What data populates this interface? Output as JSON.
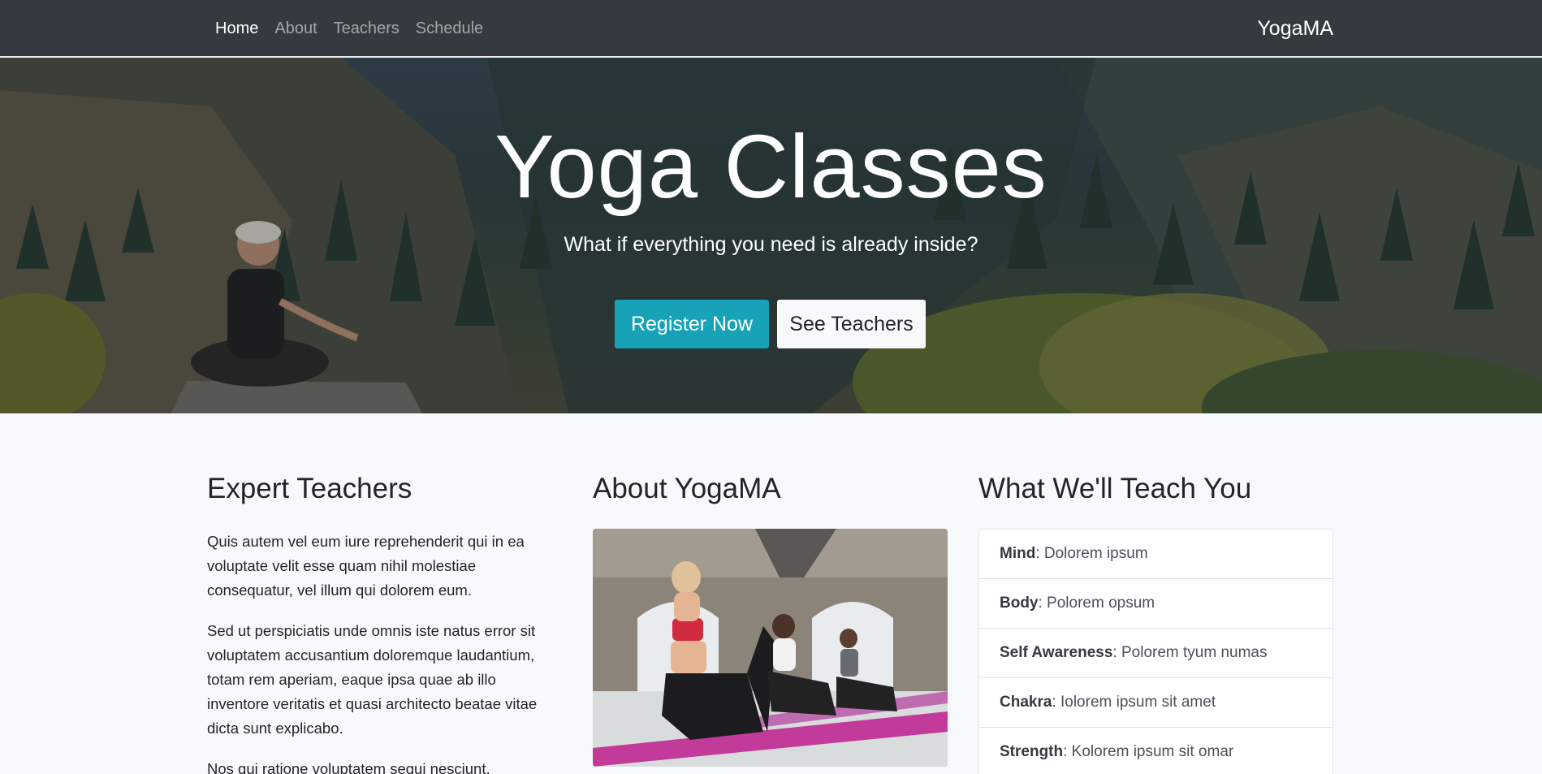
{
  "navbar": {
    "links": [
      {
        "label": "Home",
        "active": true
      },
      {
        "label": "About",
        "active": false
      },
      {
        "label": "Teachers",
        "active": false
      },
      {
        "label": "Schedule",
        "active": false
      }
    ],
    "brand": "YogaMA"
  },
  "hero": {
    "title": "Yoga Classes",
    "subtitle": "What if everything you need is already inside?",
    "primary_button": "Register Now",
    "secondary_button": "See Teachers"
  },
  "sections": {
    "teachers": {
      "heading": "Expert Teachers",
      "paragraphs": [
        "Quis autem vel eum iure reprehenderit qui in ea voluptate velit esse quam nihil molestiae consequatur, vel illum qui dolorem eum.",
        "Sed ut perspiciatis unde omnis iste natus error sit voluptatem accusantium doloremque laudantium, totam rem aperiam, eaque ipsa quae ab illo inventore veritatis et quasi architecto beatae vitae dicta sunt explicabo.",
        "Nos qui ratione voluptatem sequi nesciunt."
      ]
    },
    "about": {
      "heading": "About YogaMA"
    },
    "teach": {
      "heading": "What We'll Teach You",
      "items": [
        {
          "term": "Mind",
          "desc": ": Dolorem ipsum"
        },
        {
          "term": "Body",
          "desc": ": Polorem opsum"
        },
        {
          "term": "Self Awareness",
          "desc": ": Polorem tyum numas"
        },
        {
          "term": "Chakra",
          "desc": ": Iolorem ipsum sit amet"
        },
        {
          "term": "Strength",
          "desc": ": Kolorem ipsum sit omar"
        }
      ]
    }
  },
  "colors": {
    "navbar_bg": "#343a40",
    "primary_button": "#17a2b8",
    "page_bg": "#f8f9fa"
  }
}
